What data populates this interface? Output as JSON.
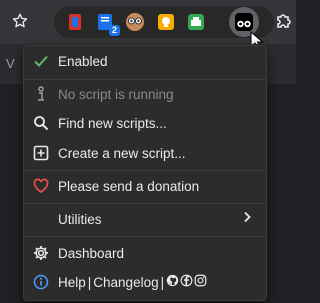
{
  "toolbar": {
    "star_icon": "star-outline-icon",
    "extensions": [
      {
        "name": "red-extension-icon"
      },
      {
        "name": "blue-document-extension-icon",
        "badge": "2"
      },
      {
        "name": "face-extension-icon"
      },
      {
        "name": "yellow-bulb-extension-icon"
      },
      {
        "name": "green-printer-extension-icon"
      },
      {
        "name": "tampermonkey-icon",
        "active": true
      }
    ],
    "puzzle_icon": "extensions-puzzle-icon"
  },
  "page": {
    "left_text": "V"
  },
  "menu": {
    "enabled_label": "Enabled",
    "no_script_label": "No script is running",
    "find_label": "Find new scripts...",
    "create_label": "Create a new script...",
    "donation_label": "Please send a donation",
    "utilities_label": "Utilities",
    "dashboard_label": "Dashboard",
    "help_label": "Help",
    "changelog_label": "Changelog",
    "divider": "|"
  },
  "colors": {
    "check": "#5bb974",
    "heart": "#e8534a",
    "info": "#4a9eff"
  }
}
